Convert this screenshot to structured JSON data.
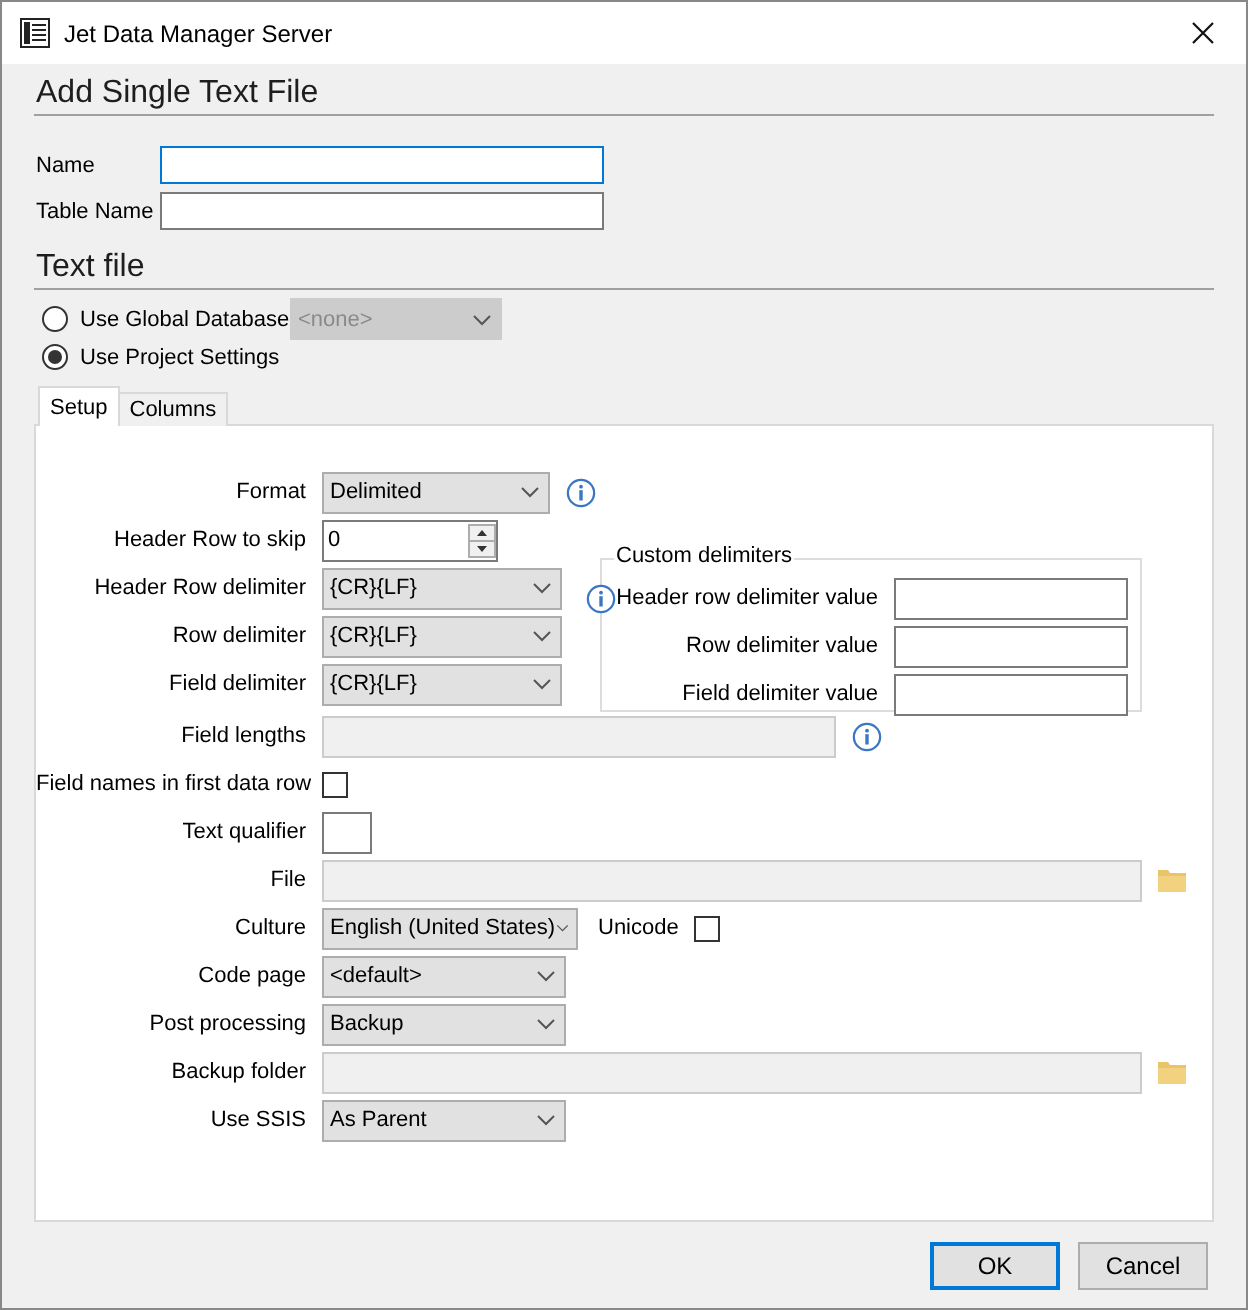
{
  "window": {
    "title": "Jet Data Manager Server"
  },
  "heading": "Add Single Text File",
  "fields": [
    {
      "label": "Name",
      "focused": true
    },
    {
      "label": "Table Name",
      "focused": false
    }
  ],
  "section_title": "Text file",
  "source_options": [
    {
      "label": "Use Global Database",
      "selected": false,
      "dropdown": "<none>"
    },
    {
      "label": "Use Project Settings",
      "selected": true
    }
  ],
  "tabs": [
    {
      "label": "Setup",
      "selected": true
    },
    {
      "label": "Columns",
      "selected": false
    }
  ],
  "setup": {
    "top_rows": [
      {
        "label": "Format",
        "kind": "dropdown",
        "value": "Delimited",
        "info": true
      },
      {
        "label": "Header Row to skip",
        "kind": "spinner",
        "value": "0",
        "info": false
      }
    ],
    "delimiter_rows": [
      {
        "label": "Header Row delimiter",
        "kind": "dropdown",
        "value": "{CR}{LF}",
        "info": false
      },
      {
        "label": "Row delimiter",
        "kind": "dropdown",
        "value": "{CR}{LF}",
        "info": false
      },
      {
        "label": "Field delimiter",
        "kind": "dropdown",
        "value": "{CR}{LF}",
        "info": false
      }
    ],
    "custom_delimiters": {
      "title": "Custom delimiters",
      "items": [
        {
          "label": "Header row delimiter value",
          "info": true
        },
        {
          "label": "Row delimiter value",
          "info": false
        },
        {
          "label": "Field delimiter value",
          "info": false
        }
      ]
    },
    "rows": [
      {
        "label": "Field lengths",
        "kind": "lengths",
        "info": true
      },
      {
        "label": "Field names in first data row",
        "kind": "checkbox",
        "checked": false
      },
      {
        "label": "Text qualifier",
        "kind": "char"
      },
      {
        "label": "File",
        "kind": "path"
      },
      {
        "label": "Culture",
        "kind": "dropdown",
        "value": "English (United States)",
        "info": false,
        "option": {
          "label": "Unicode",
          "checked": false
        }
      },
      {
        "label": "Code page",
        "kind": "dropdown",
        "value": "<default>",
        "info": false
      },
      {
        "label": "Post processing",
        "kind": "dropdown",
        "value": "Backup",
        "info": false
      },
      {
        "label": "Backup folder",
        "kind": "path"
      },
      {
        "label": "Use SSIS",
        "kind": "dropdown",
        "value": "As Parent",
        "info": false
      }
    ]
  },
  "buttons": [
    {
      "label": "OK",
      "default": true
    },
    {
      "label": "Cancel",
      "default": false
    }
  ]
}
